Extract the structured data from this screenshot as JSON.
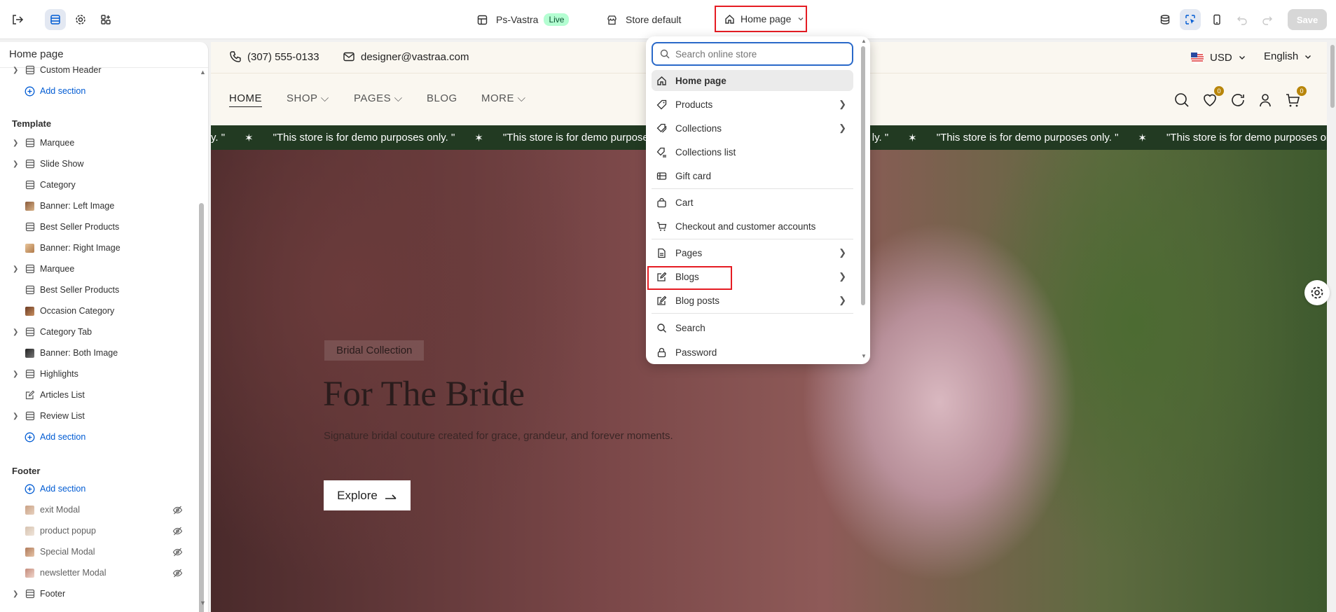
{
  "topbar": {
    "store_name": "Ps-Vastra",
    "live_label": "Live",
    "store_default": "Store default",
    "page_selector": "Home page",
    "save_label": "Save"
  },
  "sidebar": {
    "title": "Home page",
    "header_items": [
      {
        "label": "Custom Header"
      },
      {
        "label": "Add section"
      }
    ],
    "template_title": "Template",
    "template_items": [
      {
        "label": "Marquee"
      },
      {
        "label": "Slide Show"
      },
      {
        "label": "Category"
      },
      {
        "label": "Banner: Left Image"
      },
      {
        "label": "Best Seller Products"
      },
      {
        "label": "Banner: Right Image"
      },
      {
        "label": "Marquee"
      },
      {
        "label": "Best Seller Products"
      },
      {
        "label": "Occasion Category"
      },
      {
        "label": "Category Tab"
      },
      {
        "label": "Banner: Both Image"
      },
      {
        "label": "Highlights"
      },
      {
        "label": "Articles List"
      },
      {
        "label": "Review List"
      },
      {
        "label": "Add section"
      }
    ],
    "footer_title": "Footer",
    "footer_items": [
      {
        "label": "Add section"
      },
      {
        "label": "exit Modal"
      },
      {
        "label": "product popup"
      },
      {
        "label": "Special Modal"
      },
      {
        "label": "newsletter Modal"
      },
      {
        "label": "Footer"
      }
    ]
  },
  "preview": {
    "phone": "(307) 555-0133",
    "email": "designer@vastraa.com",
    "currency": "USD",
    "language": "English",
    "nav": [
      "HOME",
      "SHOP",
      "PAGES",
      "BLOG",
      "MORE"
    ],
    "wishlist_count": "0",
    "cart_count": "0",
    "marquee_text": "\"This store is for demo purposes only. \"",
    "marquee_fragment_left": "y. \"",
    "marquee_fragment_partial": "\"This store is for demo purposes or",
    "marquee_fragment_mid": "ly. \"",
    "marquee_star": "✶",
    "hero_tag": "Bridal Collection",
    "hero_title": "For The Bride",
    "hero_desc": "Signature bridal couture created for grace, grandeur, and forever moments.",
    "hero_button": "Explore"
  },
  "dropdown": {
    "search_placeholder": "Search online store",
    "items": [
      {
        "label": "Home page",
        "icon": "home-icon"
      },
      {
        "label": "Products",
        "icon": "tag-icon"
      },
      {
        "label": "Collections",
        "icon": "tags-icon"
      },
      {
        "label": "Collections list",
        "icon": "tags-list-icon"
      },
      {
        "label": "Gift card",
        "icon": "gift-card-icon"
      },
      {
        "label": "Cart",
        "icon": "bag-icon"
      },
      {
        "label": "Checkout and customer accounts",
        "icon": "cart-icon"
      },
      {
        "label": "Pages",
        "icon": "page-icon"
      },
      {
        "label": "Blogs",
        "icon": "blog-icon"
      },
      {
        "label": "Blog posts",
        "icon": "blog-post-icon"
      },
      {
        "label": "Search",
        "icon": "search-icon"
      },
      {
        "label": "Password",
        "icon": "lock-icon"
      }
    ]
  },
  "colors": {
    "accent_blue": "#005bd3",
    "highlight_red": "#e51c23",
    "marquee_bg": "#223a22",
    "live_bg": "#b4fed2"
  }
}
